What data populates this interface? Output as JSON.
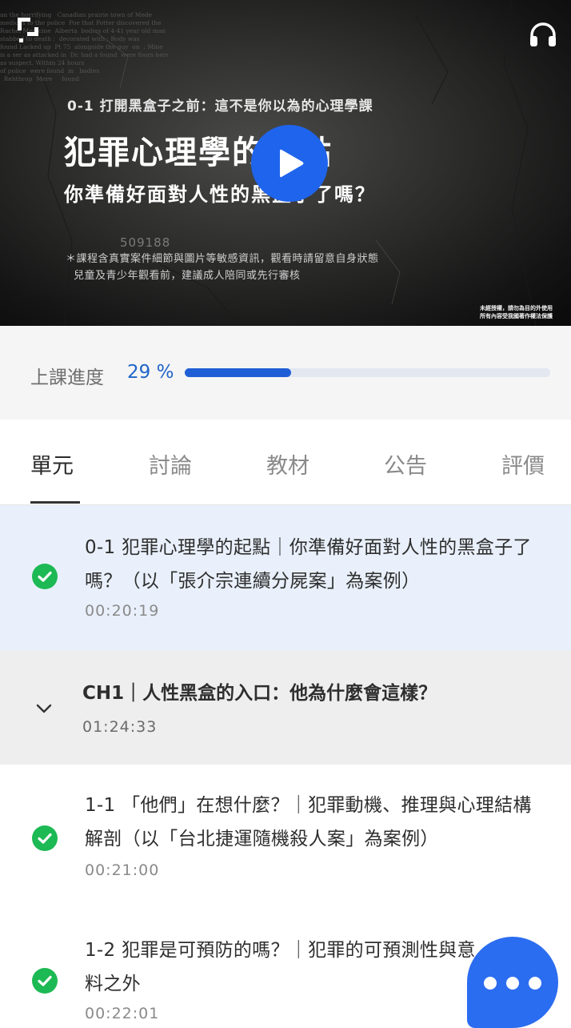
{
  "video": {
    "episode_label": "0-1 打開黑盒子之前：這不是你以為的心理學課",
    "title_line1": "犯罪心理學的起點",
    "title_line2": "你準備好面對人性的黑盒子了嗎？",
    "watermark_number": "509188",
    "notice_line1": "＊課程含真實案件細節與圖片等敏感資訊，觀看時請留意自身狀態",
    "notice_line2": "兒童及青少年觀看前，建議成人陪同或先行審核",
    "copyright_line1": "未經授權，請勿為目的外使用",
    "copyright_line2": "所有內容受我國著作權法保護",
    "background_text": "an the horrifying   Canadian prairie town of Mede\nmedicus to the police  Poe that Potter discovered the\nRachel Medicine  Alberta  bodies of 4-41 year old man\nstabbed to death ;  decorated with ; Body was\nfound Lacked up  Pt 75  alongside the guy  on  ; Mine\nis a ser as attacked in  Dr. had a found  were fours here\nas suspect. Within 24 hours\nof police  were found  in   bodies\n  Rehthrop  Mere     found"
  },
  "icons": {
    "logo": "brand-logo-icon",
    "audio": "headphone-icon",
    "play": "play-icon",
    "completed": "check-circle-icon",
    "expand": "chevron-down-icon",
    "chat": "chat-bubble-icon"
  },
  "colors": {
    "accent": "#1f64ec",
    "progress_fill": "#1f5fd6",
    "completed": "#1db954",
    "current_row": "#e9f0fb"
  },
  "progress": {
    "label": "上課進度",
    "percent_text": "29 %",
    "value": 0.29
  },
  "tabs": [
    {
      "label": "單元",
      "active": true
    },
    {
      "label": "討論",
      "active": false
    },
    {
      "label": "教材",
      "active": false
    },
    {
      "label": "公告",
      "active": false
    },
    {
      "label": "評價",
      "active": false
    }
  ],
  "lessons": [
    {
      "title": "0-1 犯罪心理學的起點｜你準備好面對人性的黑盒子了嗎？（以「張介宗連續分屍案」為案例）",
      "duration": "00:20:19",
      "completed": true
    },
    {
      "title": "1-1 「他們」在想什麼？｜犯罪動機、推理與心理結構解剖（以「台北捷運隨機殺人案」為案例）",
      "duration": "00:21:00",
      "completed": true
    },
    {
      "title": "1-2 犯罪是可預防的嗎？｜犯罪的可預測性與意料之外",
      "duration": "00:22:01",
      "completed": true
    }
  ],
  "chapter": {
    "title": "CH1｜人性黑盒的入口：他為什麼會這樣？",
    "duration": "01:24:33"
  }
}
